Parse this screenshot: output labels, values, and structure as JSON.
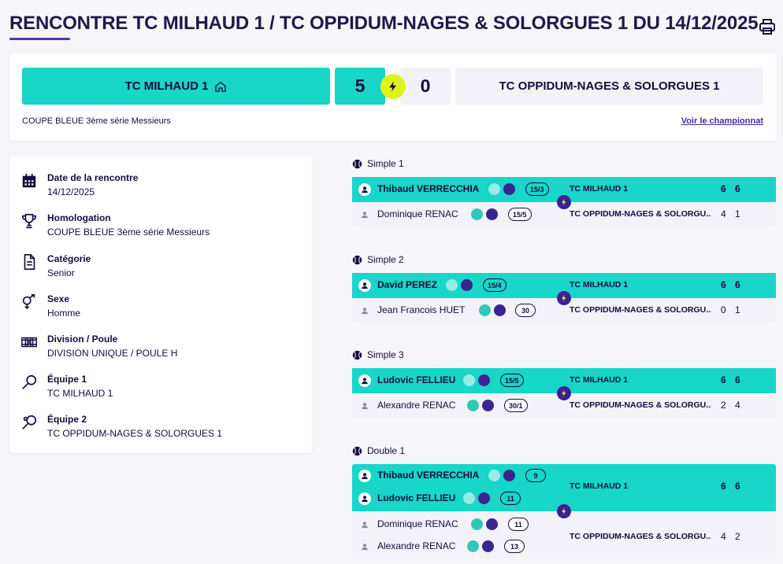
{
  "header": {
    "title": "RENCONTRE TC MILHAUD 1 / TC OPPIDUM-NAGES & SOLORGUES 1 DU 14/12/2025",
    "print_icon": "printer-icon"
  },
  "score": {
    "home_team": "TC MILHAUD 1",
    "home_icon": "home-icon",
    "home_score": "5",
    "away_score": "0",
    "away_team": "TC OPPIDUM-NAGES & SOLORGUES 1",
    "competition": "COUPE BLEUE 3ème série Messieurs",
    "link": "Voir le championnat"
  },
  "info": [
    {
      "icon": "calendar-icon",
      "label": "Date de la rencontre",
      "value": "14/12/2025"
    },
    {
      "icon": "trophy-icon",
      "label": "Homologation",
      "value": "COUPE BLEUE 3ème série Messieurs"
    },
    {
      "icon": "document-icon",
      "label": "Catégorie",
      "value": "Senior"
    },
    {
      "icon": "gender-icon",
      "label": "Sexe",
      "value": "Homme"
    },
    {
      "icon": "court-icon",
      "label": "Division / Poule",
      "value": "DIVISION UNIQUE / POULE H"
    },
    {
      "icon": "racket-icon",
      "label": "Équipe 1",
      "value": "TC MILHAUD 1"
    },
    {
      "icon": "racket-icon",
      "label": "Équipe 2",
      "value": "TC OPPIDUM-NAGES & SOLORGUES 1"
    }
  ],
  "matches": [
    {
      "title": "Simple 1",
      "winner": {
        "player": "Thibaud VERRECCHIA",
        "rank": "15/3",
        "team": "TC MILHAUD 1",
        "sets": [
          "6",
          "6"
        ]
      },
      "loser": {
        "player": "Dominique RENAC",
        "rank": "15/5",
        "team": "TC OPPIDUM-NAGES & SOLORGU...",
        "sets": [
          "4",
          "1"
        ]
      }
    },
    {
      "title": "Simple 2",
      "winner": {
        "player": "David PEREZ",
        "rank": "15/4",
        "team": "TC MILHAUD 1",
        "sets": [
          "6",
          "6"
        ]
      },
      "loser": {
        "player": "Jean Francois HUET",
        "rank": "30",
        "team": "TC OPPIDUM-NAGES & SOLORGU...",
        "sets": [
          "0",
          "1"
        ]
      }
    },
    {
      "title": "Simple 3",
      "winner": {
        "player": "Ludovic FELLIEU",
        "rank": "15/5",
        "team": "TC MILHAUD 1",
        "sets": [
          "6",
          "6"
        ]
      },
      "loser": {
        "player": "Alexandre RENAC",
        "rank": "30/1",
        "team": "TC OPPIDUM-NAGES & SOLORGU...",
        "sets": [
          "2",
          "4"
        ]
      }
    },
    {
      "title": "Double 1",
      "winner": {
        "players": [
          {
            "name": "Thibaud VERRECCHIA",
            "rank": "9"
          },
          {
            "name": "Ludovic FELLIEU",
            "rank": "11"
          }
        ],
        "team": "TC MILHAUD 1",
        "sets": [
          "6",
          "6"
        ]
      },
      "loser": {
        "players": [
          {
            "name": "Dominique RENAC",
            "rank": "11"
          },
          {
            "name": "Alexandre RENAC",
            "rank": "13"
          }
        ],
        "team": "TC OPPIDUM-NAGES & SOLORGU...",
        "sets": [
          "4",
          "2"
        ]
      }
    }
  ],
  "colors": {
    "turquoise": "#18d6c8",
    "navy": "#140c3c",
    "purple": "#3b2490",
    "lime": "#dff31b",
    "grey": "#f3f2f8"
  }
}
